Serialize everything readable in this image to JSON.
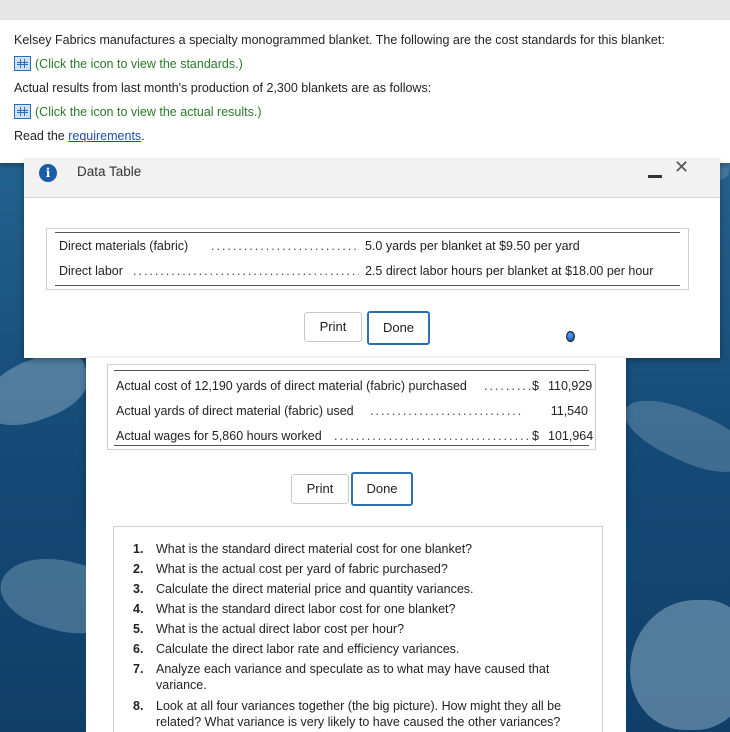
{
  "question": {
    "intro": "Kelsey Fabrics manufactures a specialty monogrammed blanket. The following are the cost standards for this blanket:",
    "standards_link": "(Click the icon to view the standards.)",
    "actual_intro": "Actual results from last month's production of 2,300 blankets are as follows:",
    "actual_link": "(Click the icon to view the actual results.)",
    "read_prefix": "Read the ",
    "requirements_link": "requirements",
    "read_suffix": "."
  },
  "standards_dialog": {
    "title": "Data Table",
    "rows": [
      {
        "label": "Direct materials (fabric)",
        "value": "5.0 yards per blanket at $9.50 per yard"
      },
      {
        "label": "Direct labor",
        "value": "2.5 direct labor hours per blanket at $18.00 per hour"
      }
    ],
    "print_label": "Print",
    "done_label": "Done"
  },
  "actual_dialog": {
    "rows": [
      {
        "label": "Actual cost of 12,190 yards of direct material (fabric) purchased",
        "currency": "$",
        "value": "110,929"
      },
      {
        "label": "Actual yards of direct material (fabric) used",
        "currency": "",
        "value": "11,540"
      },
      {
        "label": "Actual wages for 5,860 hours worked",
        "currency": "$",
        "value": "101,964"
      }
    ],
    "print_label": "Print",
    "done_label": "Done"
  },
  "requirements": [
    {
      "num": "1.",
      "text": "What is the standard direct material cost for one blanket?"
    },
    {
      "num": "2.",
      "text": "What is the actual cost per yard of fabric purchased?"
    },
    {
      "num": "3.",
      "text": "Calculate the direct material price and quantity variances."
    },
    {
      "num": "4.",
      "text": "What is the standard direct labor cost for one blanket?"
    },
    {
      "num": "5.",
      "text": "What is the actual direct labor cost per hour?"
    },
    {
      "num": "6.",
      "text": "Calculate the direct labor rate and efficiency variances."
    },
    {
      "num": "7.",
      "text": "Analyze each variance and speculate as to what may have caused that variance."
    },
    {
      "num": "8.",
      "text": "Look at all four variances together (the big picture). How might they all be related? What variance is very likely to have caused the other variances?"
    }
  ],
  "colors": {
    "link_green": "#2a7a2a",
    "link_blue": "#1a4fb0",
    "done_border": "#2d6fb5",
    "info_icon": "#1b5ca8"
  }
}
